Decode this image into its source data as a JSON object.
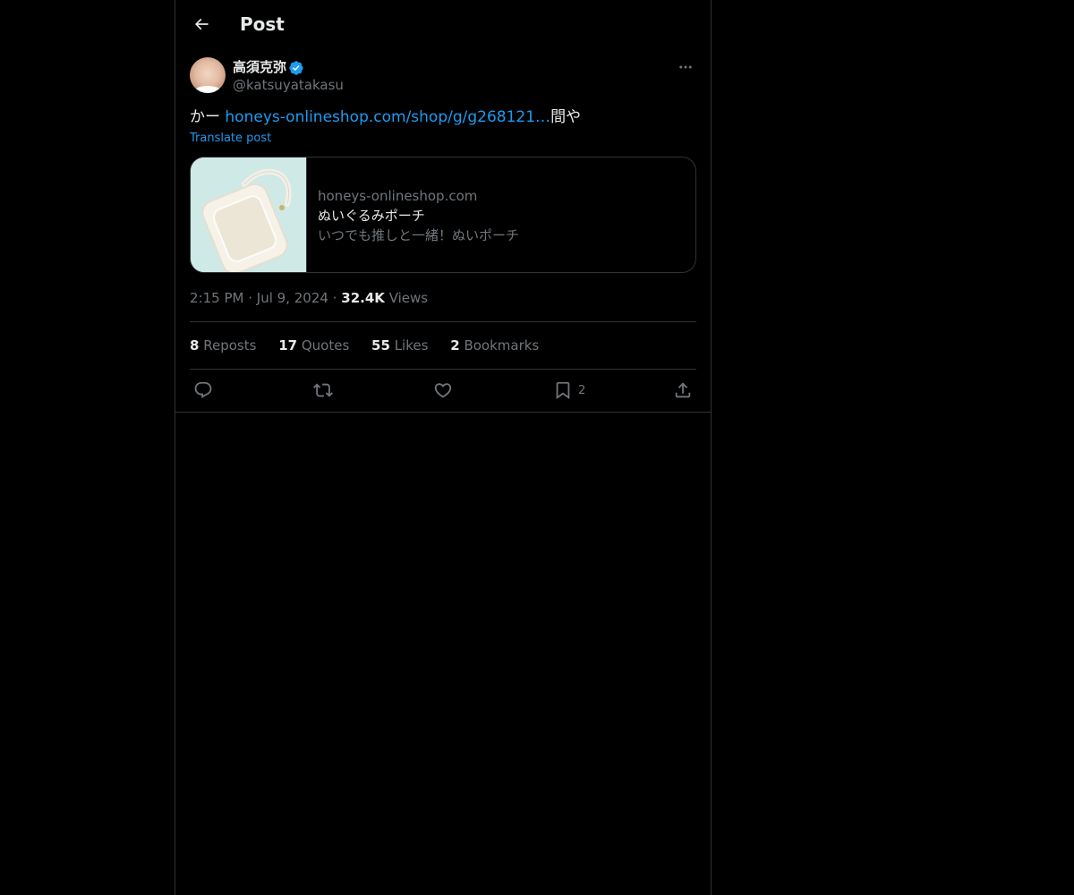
{
  "header": {
    "back_icon": "arrow-left-icon",
    "title": "Post"
  },
  "post": {
    "author": {
      "name": "高須克弥",
      "handle": "@katsuyatakasu",
      "verified": true,
      "verified_color": "#1d9bf0"
    },
    "text": {
      "prefix": "かー ",
      "link": "honeys-onlineshop.com/shop/g/g268121…",
      "suffix": "間や"
    },
    "translate_label": "Translate post",
    "card": {
      "domain": "honeys-onlineshop.com",
      "title": "ぬいぐるみポーチ",
      "description": "いつでも推しと一緒！ぬいポーチ"
    },
    "meta": {
      "time": "2:15 PM",
      "separator": "·",
      "date": "Jul 9, 2024",
      "views_count": "32.4K",
      "views_label": "Views"
    },
    "stats": [
      {
        "count": "8",
        "label": "Reposts"
      },
      {
        "count": "17",
        "label": "Quotes"
      },
      {
        "count": "55",
        "label": "Likes"
      },
      {
        "count": "2",
        "label": "Bookmarks"
      }
    ],
    "actions": {
      "reply_icon": "reply-icon",
      "repost_icon": "repost-icon",
      "like_icon": "heart-icon",
      "bookmark_icon": "bookmark-icon",
      "bookmark_count": "2",
      "share_icon": "share-icon"
    }
  },
  "colors": {
    "background": "#000000",
    "text_primary": "#e7e9ea",
    "text_secondary": "#71767b",
    "accent": "#1d9bf0",
    "border": "#2f3336"
  }
}
